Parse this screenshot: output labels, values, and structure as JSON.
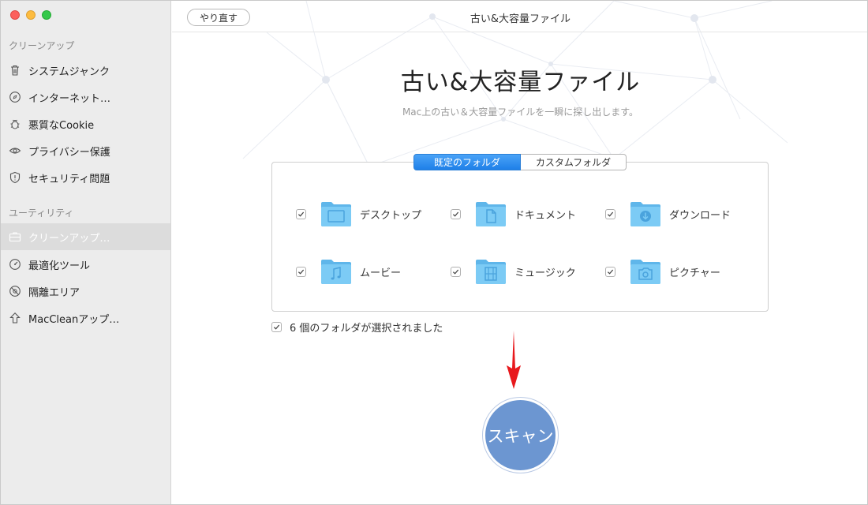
{
  "window": {
    "title": "古い&大容量ファイル"
  },
  "toolbar": {
    "undo_label": "やり直す"
  },
  "sidebar": {
    "sections": [
      {
        "title": "クリーンアップ",
        "items": [
          {
            "label": "システムジャンク",
            "icon": "trash-icon"
          },
          {
            "label": "インターネット…",
            "icon": "compass-icon"
          },
          {
            "label": "悪質なCookie",
            "icon": "bug-icon"
          },
          {
            "label": "プライバシー保護",
            "icon": "eye-icon"
          },
          {
            "label": "セキュリティ問題",
            "icon": "shield-icon"
          }
        ]
      },
      {
        "title": "ユーティリティ",
        "items": [
          {
            "label": "クリーンアップ…",
            "icon": "briefcase-icon",
            "active": true
          },
          {
            "label": "最適化ツール",
            "icon": "gauge-icon"
          },
          {
            "label": "隔離エリア",
            "icon": "quarantine-icon"
          },
          {
            "label": "MacCleanアップ…",
            "icon": "upload-arrow-icon"
          }
        ]
      }
    ]
  },
  "main": {
    "title": "古い&大容量ファイル",
    "subtitle": "Mac上の古い＆大容量ファイルを一瞬に探し出します。",
    "tabs": [
      {
        "label": "既定のフォルダ",
        "selected": true
      },
      {
        "label": "カスタムフォルダ",
        "selected": false
      }
    ],
    "folders": [
      {
        "label": "デスクトップ",
        "icon": "desktop-folder-icon",
        "checked": true
      },
      {
        "label": "ドキュメント",
        "icon": "documents-folder-icon",
        "checked": true
      },
      {
        "label": "ダウンロード",
        "icon": "downloads-folder-icon",
        "checked": true
      },
      {
        "label": "ムービー",
        "icon": "movies-folder-icon",
        "checked": true
      },
      {
        "label": "ミュージック",
        "icon": "music-folder-icon",
        "checked": true
      },
      {
        "label": "ピクチャー",
        "icon": "pictures-folder-icon",
        "checked": true
      }
    ],
    "selected_text": "6 個のフォルダが選択されました",
    "scan_label": "スキャン"
  },
  "colors": {
    "accent_blue": "#1e7fe8",
    "scan_button": "#6c96d1",
    "folder_blue": "#6cc4f5",
    "arrow_red": "#e8191d"
  }
}
